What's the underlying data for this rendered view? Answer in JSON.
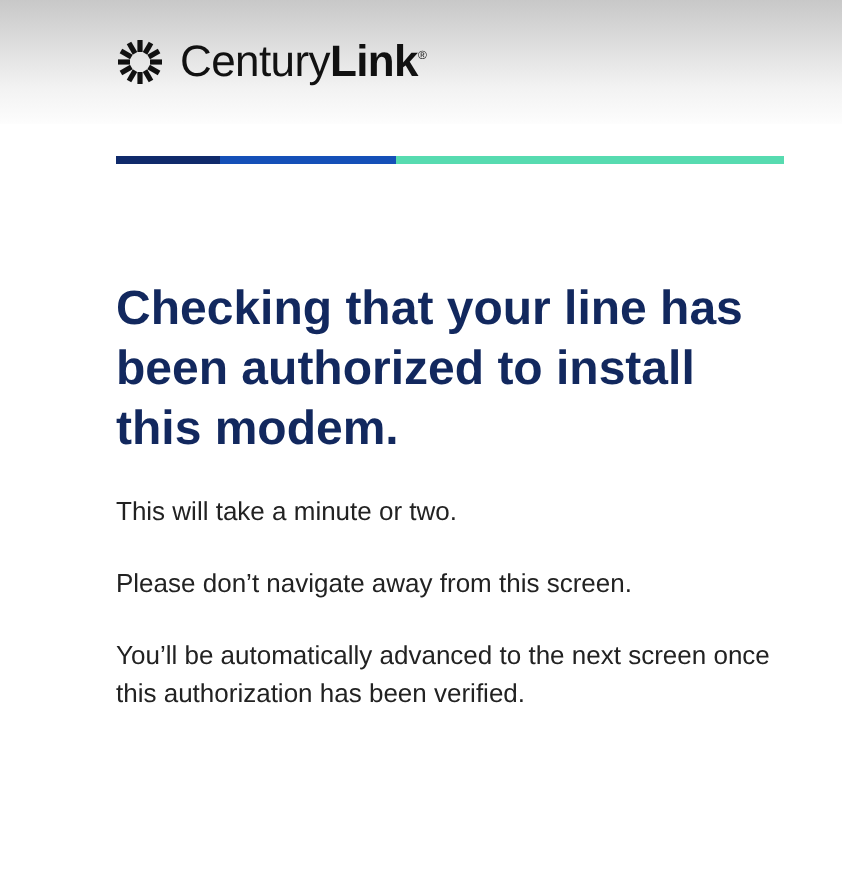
{
  "header": {
    "logo": "Century**Link**$^{®}$"
  },
  "progress": {
    "level": 0.42
  },
  "heading": "Checking that your line has been authorized to install this modem.",
  "paragraphs": [
    "This will take a minute or two.",
    "Please don’t navigate away from this screen.",
    "You’ll be automatically advanced to the next screen once this authorization has been verified."
  ]
}
